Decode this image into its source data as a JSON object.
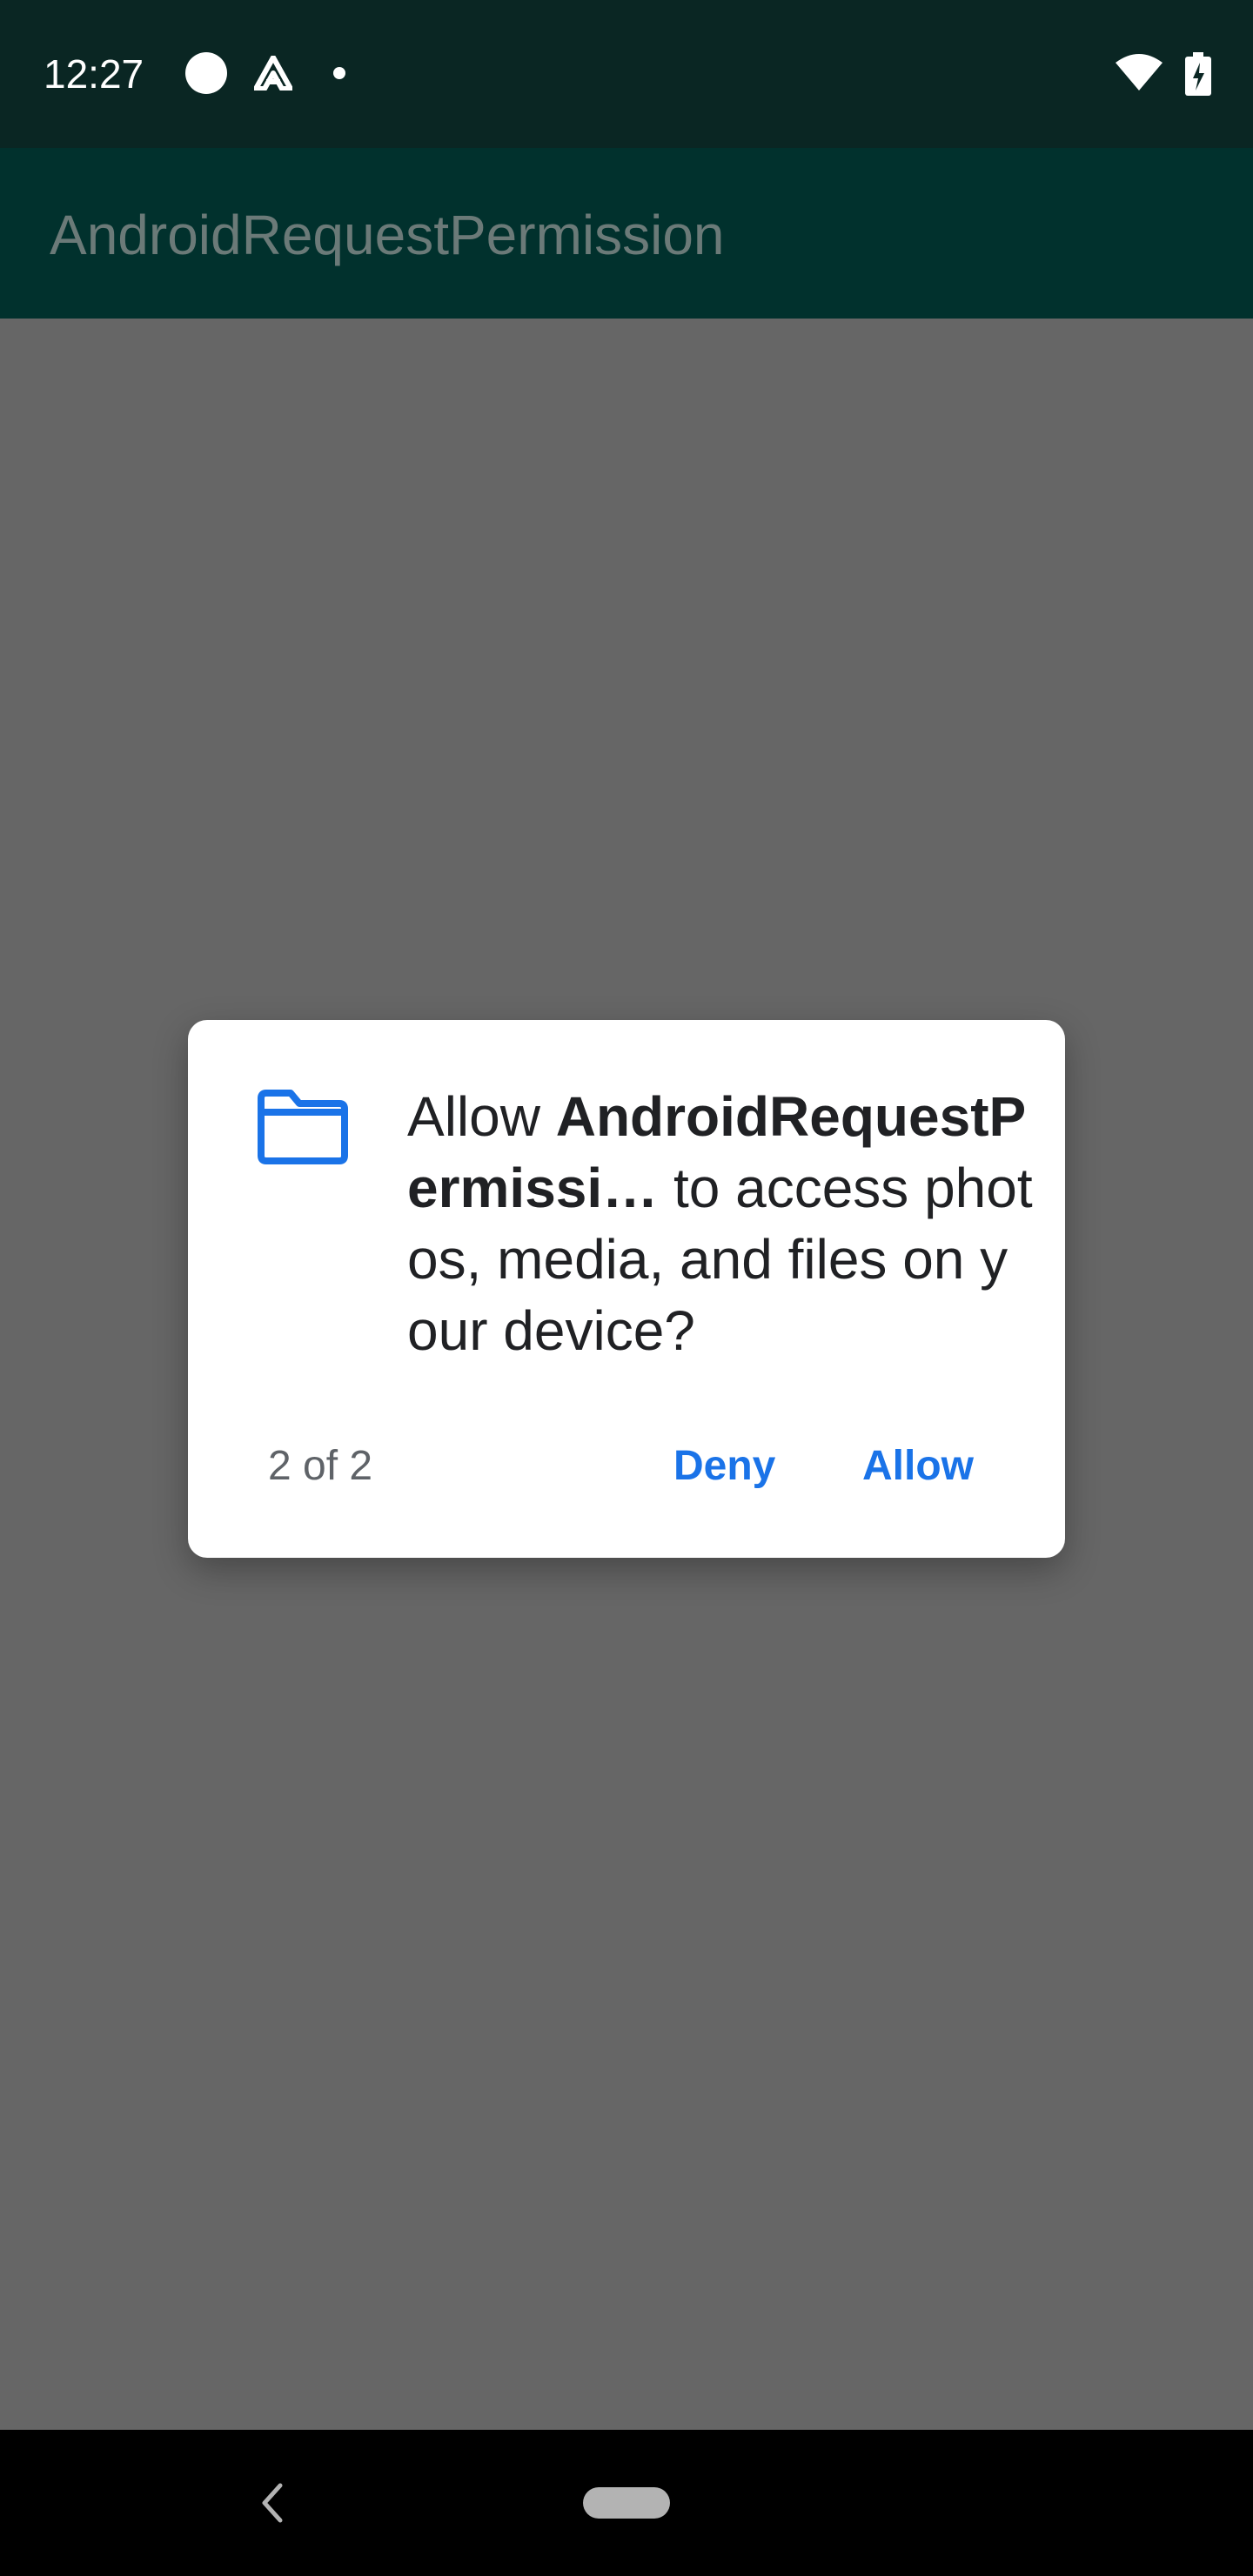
{
  "status_bar": {
    "time": "12:27",
    "icons": [
      "notification-circle-icon",
      "a-logo-icon",
      "dot-icon",
      "wifi-icon",
      "battery-icon"
    ]
  },
  "app_bar": {
    "title": "AndroidRequestPermission"
  },
  "dialog": {
    "icon": "folder-icon",
    "message_prefix": "Allow ",
    "app_name": "AndroidRequestPermissi…",
    "message_suffix": " to access photos, media, and files on your device?",
    "count": "2 of 2",
    "deny_label": "Deny",
    "allow_label": "Allow"
  },
  "nav_bar": {
    "icons": [
      "back-icon",
      "home-pill"
    ]
  },
  "colors": {
    "status_bar": "#0a2623",
    "app_bar": "#01312d",
    "scrim": "#666666",
    "accent": "#1a73e8",
    "dialog_bg": "#ffffff"
  }
}
